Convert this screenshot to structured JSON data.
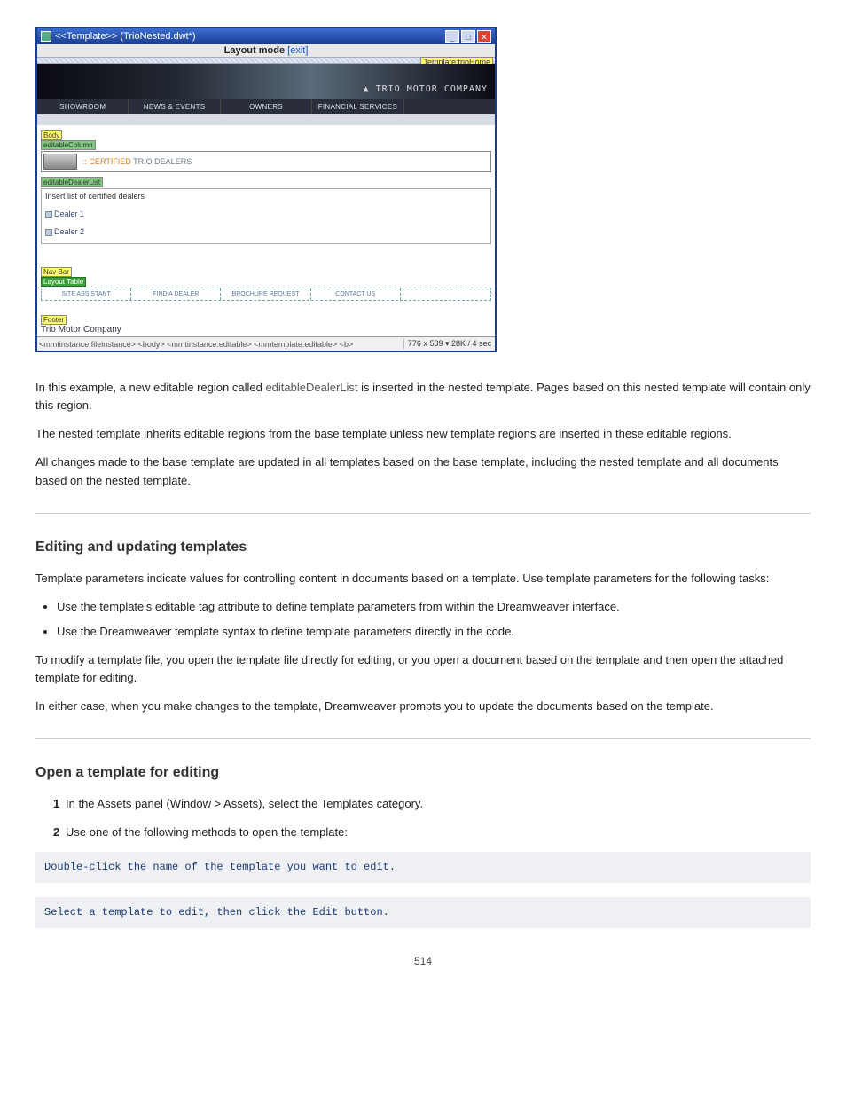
{
  "window": {
    "title": "<<Template>> (TrioNested.dwt*)",
    "layout_mode_prefix": "Layout mode ",
    "layout_mode_link": "[exit]",
    "template_label": "Template:trioHome",
    "brand_text": "TRIO MOTOR COMPANY",
    "nav": [
      "SHOWROOM",
      "NEWS & EVENTS",
      "OWNERS",
      "FINANCIAL SERVICES",
      ""
    ],
    "body_tag": "Body",
    "editcol_tag": "editableColumn",
    "cert_label_b": ":: CERTIFIED",
    "cert_label_rest": " TRIO DEALERS",
    "editlist_tag": "editableDealerList",
    "insert_text": "Insert list of certified dealers",
    "dealer1": "Dealer 1",
    "dealer2": "Dealer 2",
    "navbar_tag": "Nav Bar",
    "layout_table_tag": "Layout Table",
    "utilnav": [
      "SITE ASSISTANT",
      "FIND A DEALER",
      "BROCHURE REQUEST",
      "CONTACT US",
      ""
    ],
    "footer_tag": "Footer",
    "company": "Trio Motor Company",
    "tagpath": "<mmtinstance:fileinstance> <body> <mmtinstance:editable> <mmtemplate:editable> <b>",
    "statusinfo": "776 x 539 ▾ 28K / 4 sec"
  },
  "text": {
    "sent1_a": "In this example, a new editable region called ",
    "sent1_code": "editableDealerList",
    "sent1_b": " is inserted in the nested template. Pages based on this nested template will contain only this region.",
    "sent2": "The nested template inherits editable regions from the base template unless new template regions are inserted in these editable regions.",
    "sent3": "All changes made to the base template are updated in all templates based on the base template, including the nested template and all documents based on the nested template.",
    "h_params": "Editing and updating templates",
    "params_p": "Template parameters indicate values for controlling content in documents based on a template. Use template parameters for the following tasks:",
    "bullets": [
      "Use the template's editable tag attribute to define template parameters from within the Dreamweaver interface.",
      "Use the Dreamweaver template syntax to define template parameters directly in the code."
    ],
    "params_p2": "To modify a template file, you open the template file directly for editing, or you open a document based on the template and then open the attached template for editing.",
    "params_p3": "In either case, when you make changes to the template, Dreamweaver prompts you to update the documents based on the template.",
    "h_open": "Open a template for editing",
    "step1": "In the Assets panel (Window > Assets), select the Templates category.",
    "step2": "Use one of the following methods to open the template:",
    "code1": "Double-click the name of the template you want to edit.",
    "code2": "Select a template to edit, then click the Edit button."
  },
  "pagenum": "514"
}
